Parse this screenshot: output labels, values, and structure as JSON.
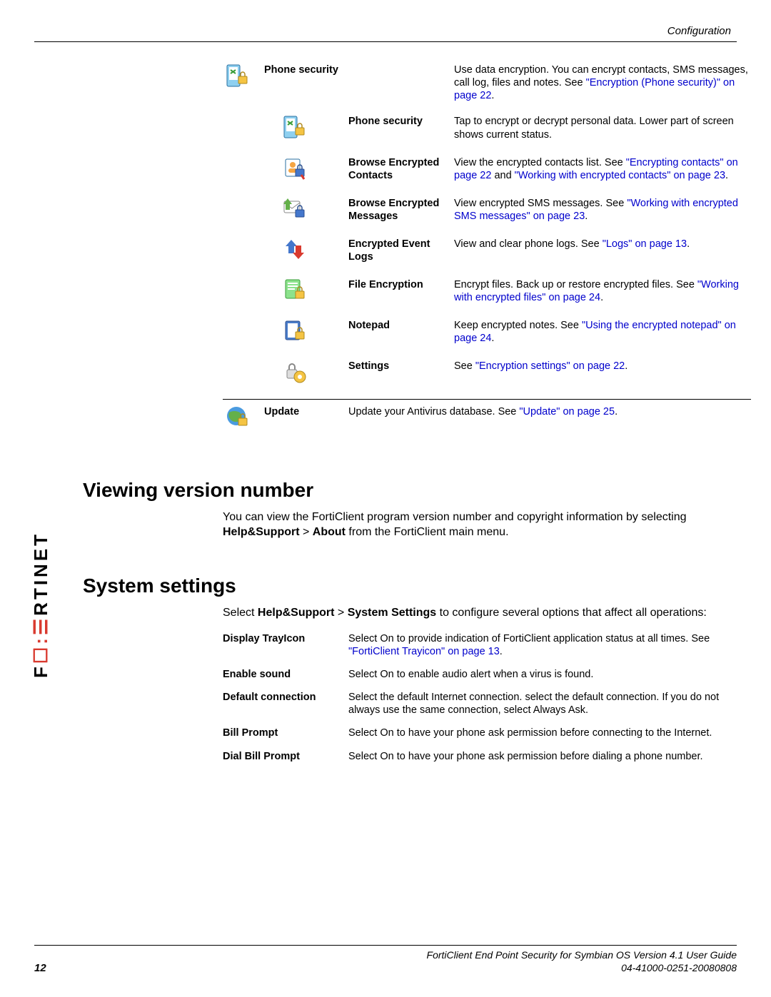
{
  "header": {
    "section": "Configuration"
  },
  "logo": {
    "text_plain": "F",
    "text_red": "☐",
    "text_rest": "RTINET"
  },
  "features": [
    {
      "icon": "phone-security-icon",
      "label": "Phone security",
      "desc_pre": "Use data encryption. You can encrypt contacts, SMS messages, call log, files and notes. See ",
      "xref1": "\"Encryption (Phone security)\" on page 22",
      "desc_post": ".",
      "sub": [
        {
          "icon": "phone-security-sub-icon",
          "label": "Phone security",
          "desc": "Tap to encrypt or decrypt personal data. Lower part of screen shows current status."
        },
        {
          "icon": "browse-contacts-icon",
          "label": "Browse Encrypted Contacts",
          "desc_pre": "View the encrypted contacts list. See ",
          "xref1": "\"Encrypting contacts\" on page 22",
          "mid": " and ",
          "xref2": "\"Working with encrypted contacts\" on page 23",
          "desc_post": "."
        },
        {
          "icon": "browse-messages-icon",
          "label": "Browse Encrypted Messages",
          "desc_pre": "View encrypted SMS messages. See ",
          "xref1": "\"Working with encrypted SMS messages\" on page 23",
          "desc_post": "."
        },
        {
          "icon": "event-logs-icon",
          "label": "Encrypted Event Logs",
          "desc_pre": "View and clear phone logs. See ",
          "xref1": "\"Logs\" on page 13",
          "desc_post": "."
        },
        {
          "icon": "file-encryption-icon",
          "label": "File Encryption",
          "desc_pre": "Encrypt files. Back up or restore encrypted files. See ",
          "xref1": "\"Working with encrypted files\" on page 24",
          "desc_post": "."
        },
        {
          "icon": "notepad-icon",
          "label": "Notepad",
          "desc_pre": "Keep encrypted notes. See ",
          "xref1": "\"Using the encrypted notepad\" on page 24",
          "desc_post": "."
        },
        {
          "icon": "settings-icon",
          "label": "Settings",
          "desc_pre": "See ",
          "xref1": "\"Encryption settings\" on page 22",
          "desc_post": "."
        }
      ]
    },
    {
      "icon": "update-icon",
      "label": "Update",
      "desc_pre": "Update your Antivirus database. See ",
      "xref1": "\"Update\" on page 25",
      "desc_post": ".",
      "divider": true
    }
  ],
  "viewing": {
    "heading": "Viewing version number",
    "body_pre": "You can view the FortiClient program version number and copyright information by selecting ",
    "bold": "Help&Support",
    "gt": " > ",
    "bold2": "About",
    "body_post": " from the FortiClient main menu."
  },
  "system": {
    "heading": "System settings",
    "body_pre": "Select ",
    "bold": "Help&Support",
    "gt": " > ",
    "bold2": "System Settings",
    "body_post": " to configure several options that affect all operations:",
    "rows": [
      {
        "label": "Display TrayIcon",
        "desc_pre": "Select On to provide indication of FortiClient application status at all times. See ",
        "xref": "\"FortiClient Trayicon\" on page 13",
        "desc_post": "."
      },
      {
        "label": "Enable sound",
        "desc": "Select On to enable audio alert when a virus is found."
      },
      {
        "label": "Default connection",
        "desc": "Select the default Internet connection. select the default connection. If you do not always use the same connection, select Always Ask."
      },
      {
        "label": "Bill Prompt",
        "desc": "Select On to have your phone ask permission before connecting to the Internet."
      },
      {
        "label": "Dial Bill Prompt",
        "desc": "Select On to have your phone ask permission before dialing a phone number."
      }
    ]
  },
  "footer": {
    "page": "12",
    "title": "FortiClient End Point Security for Symbian OS Version 4.1 User Guide",
    "docnum": "04-41000-0251-20080808"
  }
}
